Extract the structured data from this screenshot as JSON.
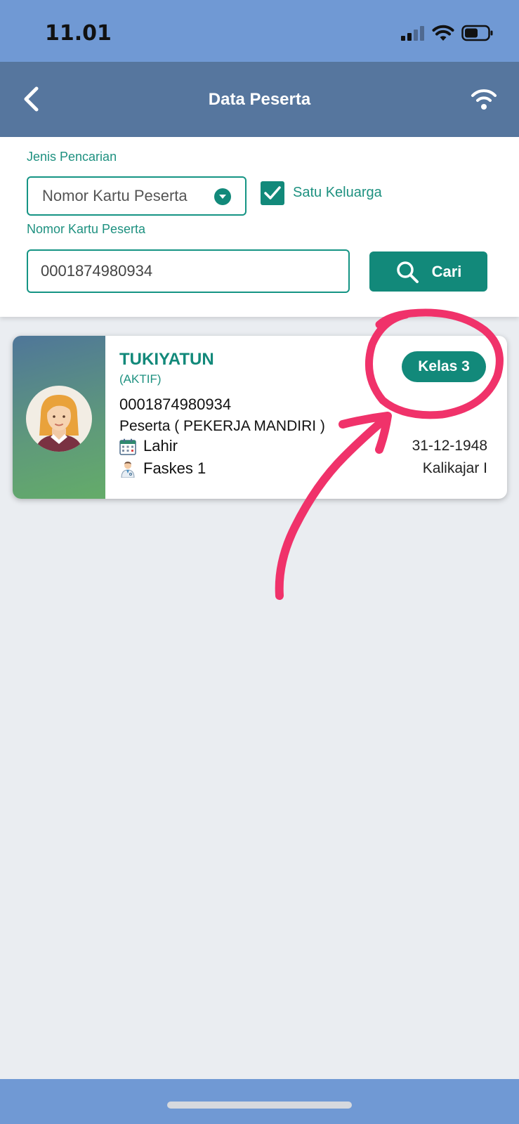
{
  "status_bar": {
    "time": "11.01"
  },
  "app_bar": {
    "title": "Data Peserta"
  },
  "search": {
    "type_label": "Jenis Pencarian",
    "type_value": "Nomor Kartu Peserta",
    "family_label": "Satu Keluarga",
    "family_checked": true,
    "field_label": "Nomor Kartu Peserta",
    "field_value": "0001874980934",
    "button_label": "Cari"
  },
  "participant": {
    "name": "TUKIYATUN",
    "status": "(AKTIF)",
    "card_number": "0001874980934",
    "type": "Peserta ( PEKERJA MANDIRI )",
    "class_badge": "Kelas 3",
    "birth_label": "Lahir",
    "birth_date": "31-12-1948",
    "facility_label": "Faskes 1",
    "facility_value": "Kalikajar I"
  },
  "colors": {
    "teal": "#12897a",
    "header": "#56769e",
    "status_bar": "#7099d4",
    "annotation": "#f0326a"
  },
  "icons": [
    "back-arrow-icon",
    "wifi-icon",
    "search-icon",
    "calendar-icon",
    "doctor-icon",
    "avatar-woman-icon"
  ]
}
